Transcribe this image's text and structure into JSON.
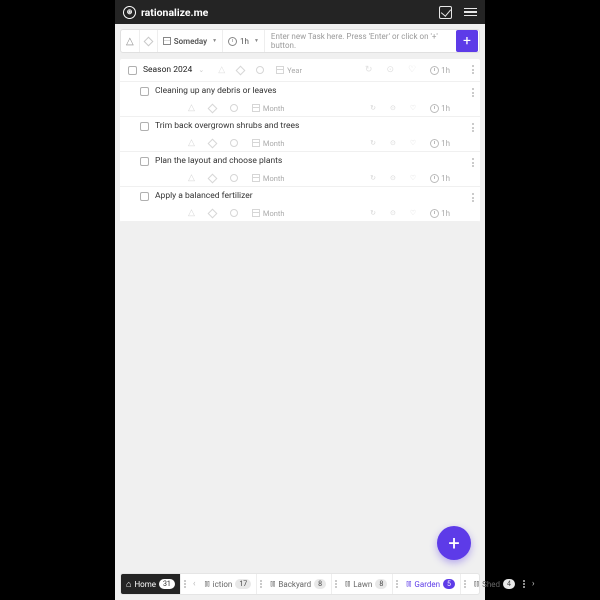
{
  "app_title": "rationalize.me",
  "input_bar": {
    "schedule_label": "Someday",
    "duration_label": "1h",
    "placeholder": "Enter new Task here. Press 'Enter' or click on '+' button."
  },
  "group": {
    "title": "Season 2024",
    "period": "Year",
    "duration": "1h"
  },
  "tasks": [
    {
      "title": "Cleaning up any debris or leaves",
      "period": "Month",
      "duration": "1h"
    },
    {
      "title": "Trim back overgrown shrubs and trees",
      "period": "Month",
      "duration": "1h"
    },
    {
      "title": "Plan the layout and choose plants",
      "period": "Month",
      "duration": "1h"
    },
    {
      "title": "Apply a balanced fertilizer",
      "period": "Month",
      "duration": "1h"
    }
  ],
  "tabs": {
    "home": {
      "label": "Home",
      "count": "31"
    },
    "items": [
      {
        "label": "iction",
        "count": "17",
        "active": false
      },
      {
        "label": "Backyard",
        "count": "8",
        "active": false
      },
      {
        "label": "Lawn",
        "count": "8",
        "active": false
      },
      {
        "label": "Garden",
        "count": "5",
        "active": true
      },
      {
        "label": "Shed",
        "count": "4",
        "active": false
      }
    ]
  }
}
